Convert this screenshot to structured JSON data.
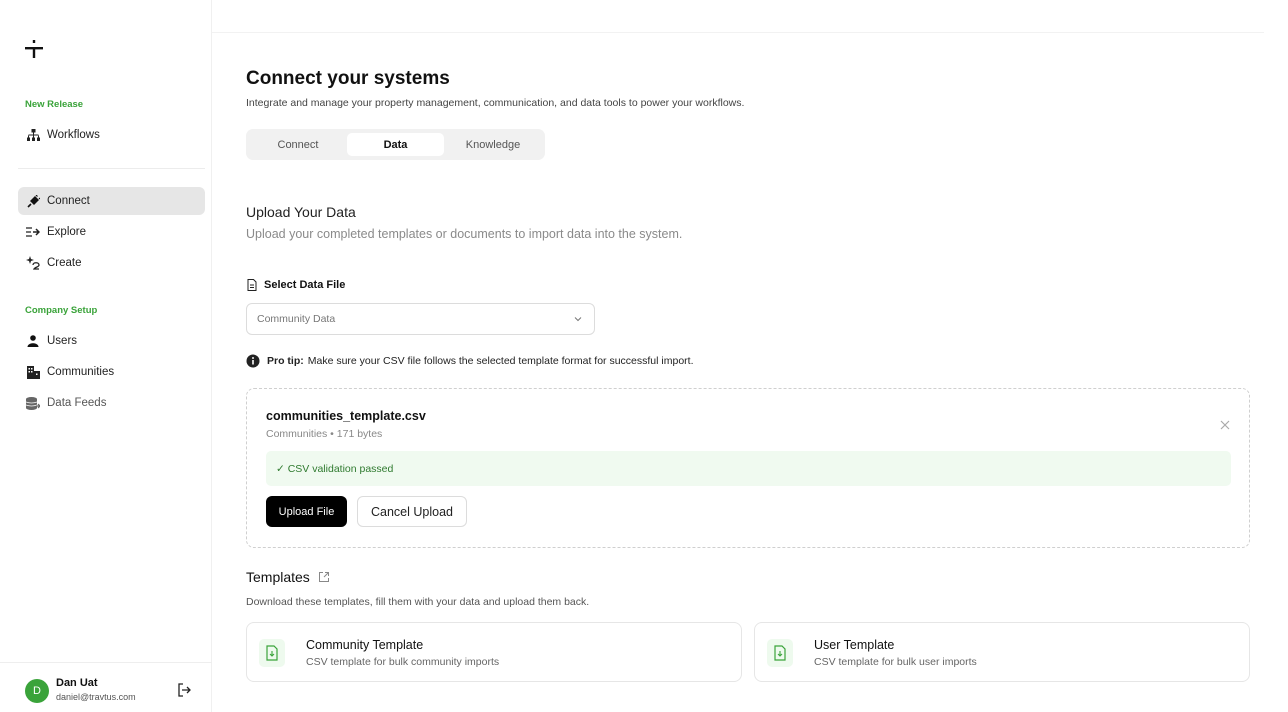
{
  "sidebar": {
    "sections": {
      "new_release": "New Release",
      "company_setup": "Company Setup"
    },
    "items": {
      "workflows": "Workflows",
      "connect": "Connect",
      "explore": "Explore",
      "create": "Create",
      "users": "Users",
      "communities": "Communities",
      "data_feeds": "Data Feeds"
    },
    "icons": {
      "logo": "plus-divide-logo",
      "workflows": "hierarchy-icon",
      "connect": "plug-icon",
      "explore": "explore-arrow-icon",
      "create": "sparkle-create-icon",
      "users": "user-icon",
      "communities": "building-icon",
      "data_feeds": "database-icon"
    },
    "user": {
      "initial": "D",
      "name": "Dan Uat",
      "email": "daniel@travtus.com"
    }
  },
  "header": {
    "title": "Connect your systems",
    "subtitle": "Integrate and manage your property management, communication, and data tools to power your workflows."
  },
  "tabs": [
    {
      "label": "Connect",
      "active": false
    },
    {
      "label": "Data",
      "active": true
    },
    {
      "label": "Knowledge",
      "active": false
    }
  ],
  "upload": {
    "title": "Upload Your Data",
    "subtitle": "Upload your completed templates or documents to import data into the system.",
    "select_label": "Select Data File",
    "select_value": "Community Data",
    "protip_bold": "Pro tip:",
    "protip_text": "Make sure your CSV file follows the selected template format for successful import."
  },
  "file": {
    "name": "communities_template.csv",
    "meta": "Communities • 171 bytes",
    "validation": "✓ CSV validation passed",
    "upload_button": "Upload File",
    "cancel_button": "Cancel Upload"
  },
  "templates": {
    "title": "Templates",
    "subtitle": "Download these templates, fill them with your data and upload them back.",
    "items": [
      {
        "name": "Community Template",
        "desc": "CSV template for bulk community imports"
      },
      {
        "name": "User Template",
        "desc": "CSV template for bulk user imports"
      }
    ]
  },
  "colors": {
    "accent_green": "#3aa33a",
    "primary_button": "#000000",
    "validation_bg": "#f0faf0"
  }
}
